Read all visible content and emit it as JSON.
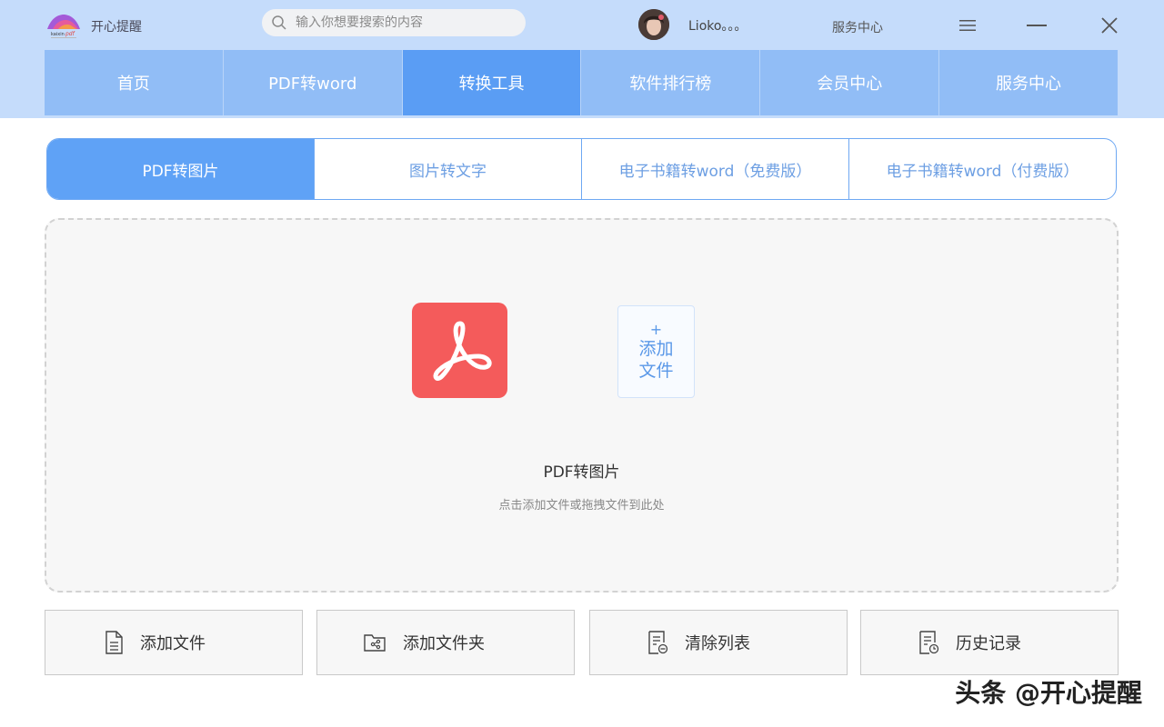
{
  "header": {
    "app_name": "开心提醒",
    "search_placeholder": "输入你想要搜索的内容",
    "username": "Lioko。。。",
    "service_center": "服务中心"
  },
  "nav": {
    "items": [
      {
        "label": "首页"
      },
      {
        "label": "PDF转word"
      },
      {
        "label": "转换工具"
      },
      {
        "label": "软件排行榜"
      },
      {
        "label": "会员中心"
      },
      {
        "label": "服务中心"
      }
    ],
    "active_index": 2
  },
  "subtabs": {
    "items": [
      {
        "label": "PDF转图片"
      },
      {
        "label": "图片转文字"
      },
      {
        "label": "电子书籍转word（免费版）"
      },
      {
        "label": "电子书籍转word（付费版）"
      }
    ],
    "active_index": 0
  },
  "dropzone": {
    "add_plus": "+",
    "add_label": "添加文件",
    "title": "PDF转图片",
    "hint": "点击添加文件或拖拽文件到此处"
  },
  "actions": {
    "add_file": "添加文件",
    "add_folder": "添加文件夹",
    "clear_list": "清除列表",
    "history": "历史记录"
  },
  "watermark": "头条 @开心提醒",
  "colors": {
    "header_bg": "#c5dcfb",
    "nav_bg": "#91bdf6",
    "nav_active": "#5a9df4",
    "tab_active": "#5fa2f6",
    "pdf_red": "#f45b5b",
    "accent_blue": "#5a98e8"
  }
}
